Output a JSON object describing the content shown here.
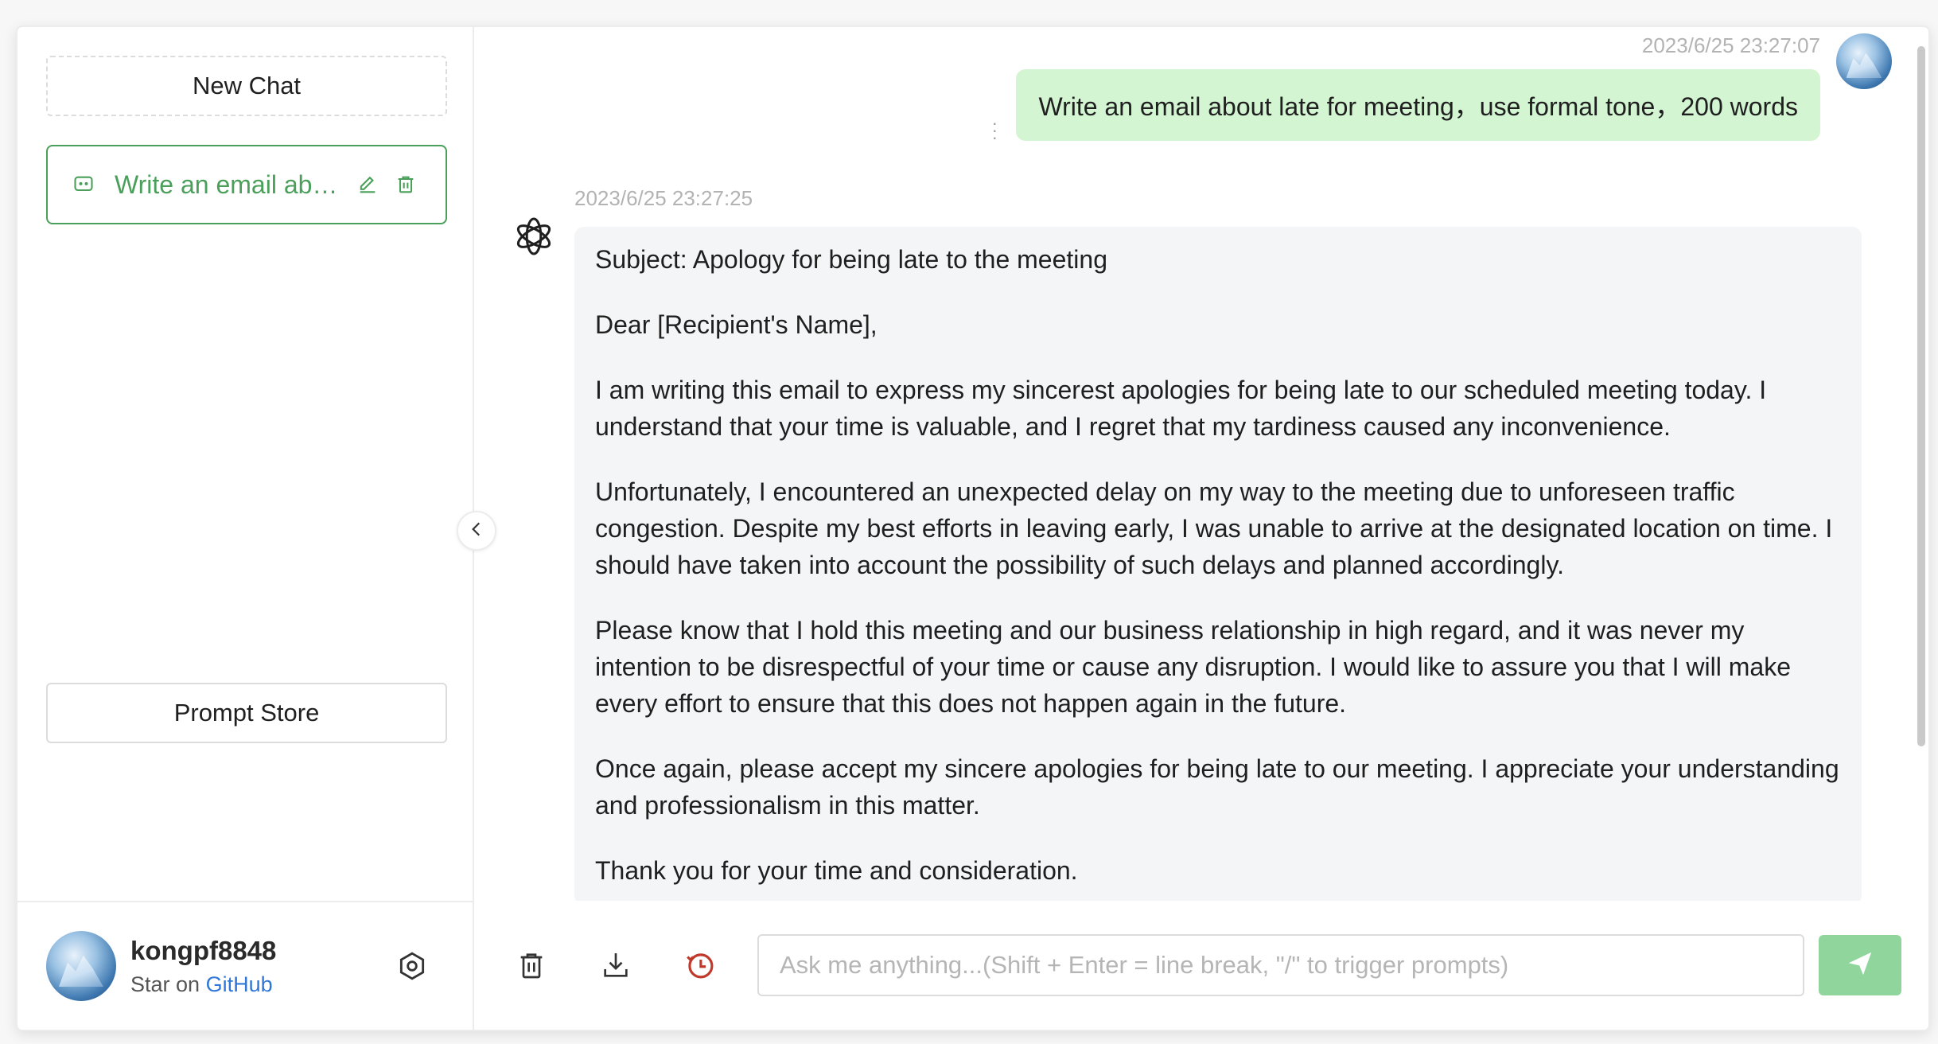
{
  "sidebar": {
    "new_chat_label": "New Chat",
    "chat_items": [
      {
        "title": "Write an email abo..."
      }
    ],
    "prompt_store_label": "Prompt Store",
    "user": {
      "name": "kongpf8848",
      "star_text": "Star on",
      "github_label": "GitHub"
    }
  },
  "messages": {
    "user": {
      "timestamp": "2023/6/25 23:27:07",
      "text": "Write an email about late for meeting，use formal tone，200 words"
    },
    "assistant": {
      "timestamp": "2023/6/25 23:27:25",
      "paragraphs": [
        "Subject: Apology for being late to the meeting",
        "Dear [Recipient's Name],",
        "I am writing this email to express my sincerest apologies for being late to our scheduled meeting today. I understand that your time is valuable, and I regret that my tardiness caused any inconvenience.",
        "Unfortunately, I encountered an unexpected delay on my way to the meeting due to unforeseen traffic congestion. Despite my best efforts in leaving early, I was unable to arrive at the designated location on time. I should have taken into account the possibility of such delays and planned accordingly.",
        "Please know that I hold this meeting and our business relationship in high regard, and it was never my intention to be disrespectful of your time or cause any disruption. I would like to assure you that I will make every effort to ensure that this does not happen again in the future.",
        "Once again, please accept my sincere apologies for being late to our meeting. I appreciate your understanding and professionalism in this matter.",
        "Thank you for your time and consideration."
      ]
    }
  },
  "input": {
    "placeholder": "Ask me anything...(Shift + Enter = line break, \"/\" to trigger prompts)",
    "value": ""
  },
  "colors": {
    "accent_green": "#4a9f5a",
    "user_bubble": "#d3f5d2",
    "send_button": "#8fd59c",
    "history_icon": "#c0392b",
    "link_blue": "#2f77d6"
  },
  "icons": [
    "message-icon",
    "edit-icon",
    "delete-icon",
    "chevron-left-icon",
    "gear-icon",
    "trash-icon",
    "download-icon",
    "history-icon",
    "send-icon",
    "openai-icon"
  ]
}
